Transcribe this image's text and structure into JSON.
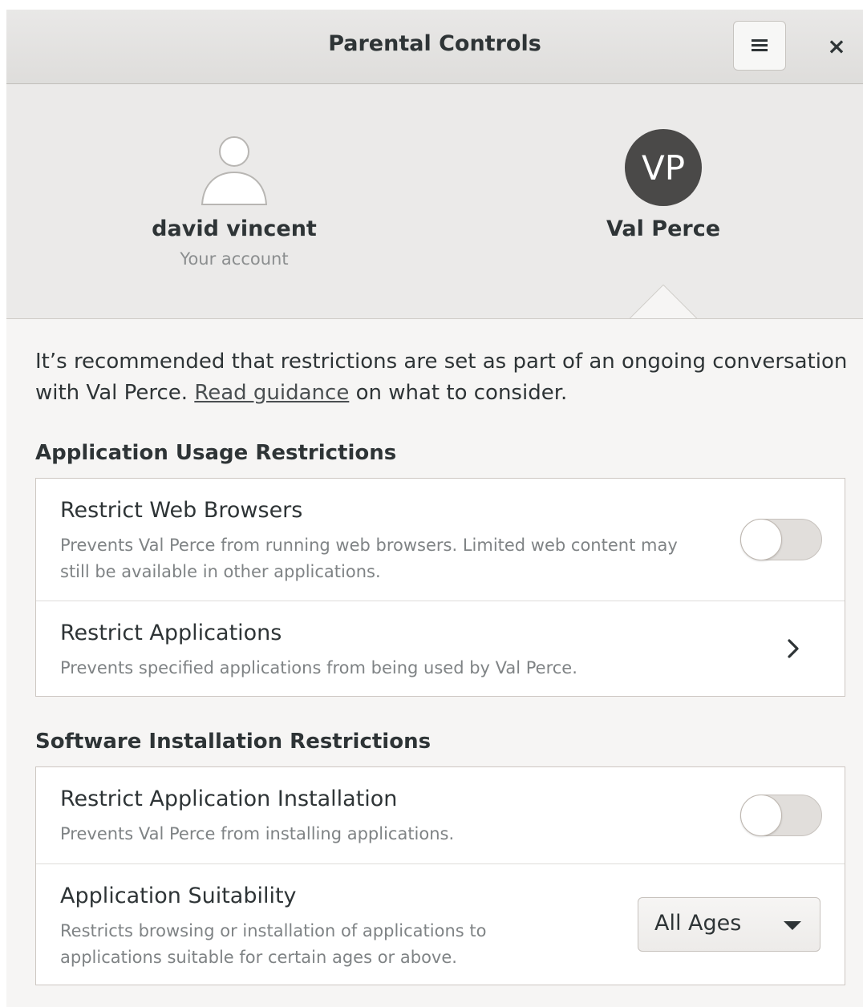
{
  "window": {
    "title": "Parental Controls",
    "menu_icon": "hamburger-menu-icon",
    "close_label": "×"
  },
  "users": [
    {
      "name": "david vincent",
      "subtitle": "Your account",
      "avatar": "generic-person-icon"
    },
    {
      "name": "Val Perce",
      "subtitle": "",
      "initials": "VP",
      "avatar_color": "#4a4948",
      "selected": true
    }
  ],
  "intro": {
    "before_link": "It’s recommended that restrictions are set as part of an ongoing conversation with Val Perce. ",
    "link": "Read guidance",
    "after_link": " on what to consider."
  },
  "sections": {
    "usage": {
      "title": "Application Usage Restrictions",
      "rows": [
        {
          "title": "Restrict Web Browsers",
          "description": "Prevents Val Perce from running web browsers. Limited web content may still be available in other applications.",
          "control": "switch",
          "enabled": false
        },
        {
          "title": "Restrict Applications",
          "description": "Prevents specified applications from being used by Val Perce.",
          "control": "chevron-right-icon"
        }
      ]
    },
    "installation": {
      "title": "Software Installation Restrictions",
      "rows": [
        {
          "title": "Restrict Application Installation",
          "description": "Prevents Val Perce from installing applications.",
          "control": "switch",
          "enabled": false
        },
        {
          "title": "Application Suitability",
          "description": "Restricts browsing or installation of applications to applications suitable for certain ages or above.",
          "control": "dropdown",
          "selected": "All Ages"
        }
      ]
    }
  }
}
